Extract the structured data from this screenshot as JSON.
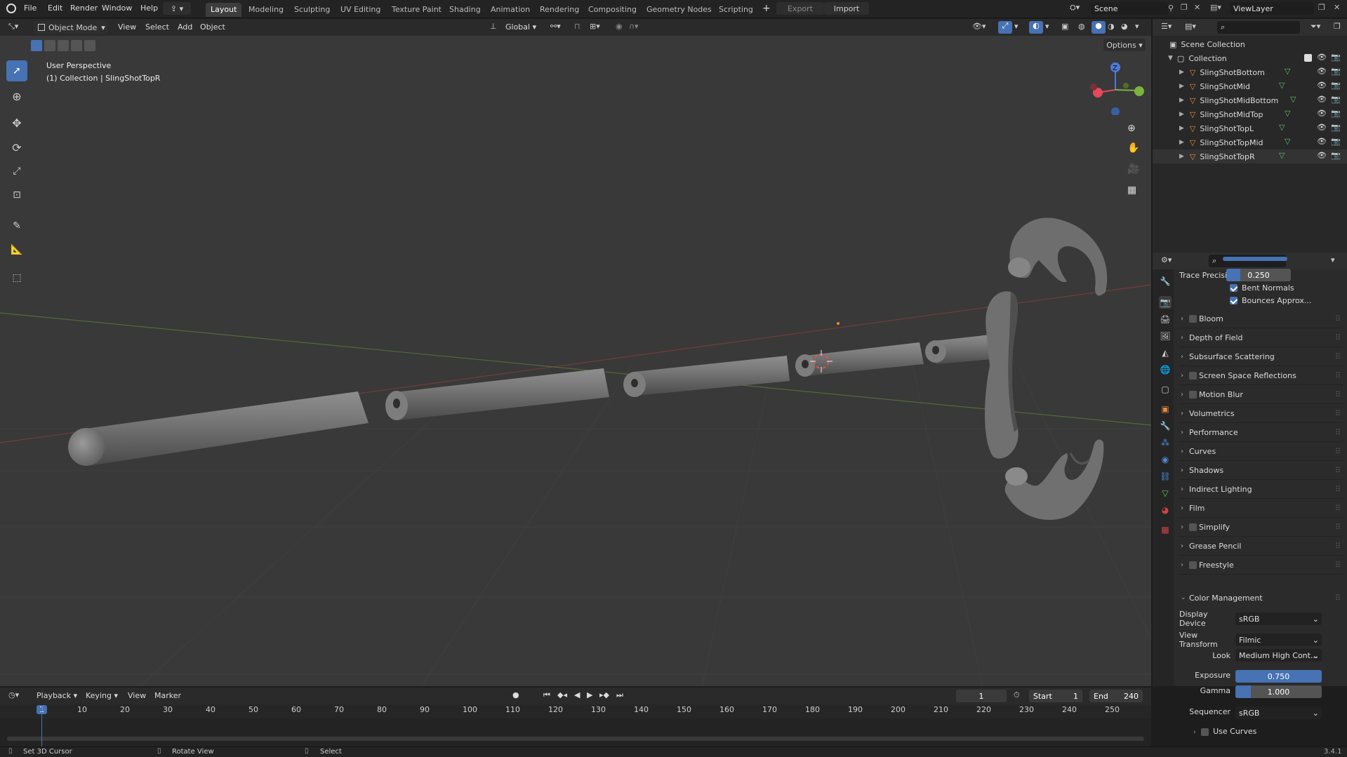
{
  "menubar": {
    "items": [
      "File",
      "Edit",
      "Render",
      "Window",
      "Help"
    ],
    "workspaces": [
      "Layout",
      "Modeling",
      "Sculpting",
      "UV Editing",
      "Texture Paint",
      "Shading",
      "Animation",
      "Rendering",
      "Compositing",
      "Geometry Nodes",
      "Scripting"
    ],
    "plus": "+",
    "export_label": "Export",
    "import_label": "Import",
    "scene_name": "Scene",
    "view_layer": "ViewLayer"
  },
  "viewport_header": {
    "mode": "Object Mode",
    "menus": [
      "View",
      "Select",
      "Add",
      "Object"
    ],
    "orientation": "Global",
    "options_label": "Options"
  },
  "viewport": {
    "perspective_label": "User Perspective",
    "collection_label": "(1) Collection | SlingShotTopR",
    "gizmo_z": "Z"
  },
  "outliner": {
    "scene_collection": "Scene Collection",
    "collection": "Collection",
    "objects": [
      "SlingShotBottom",
      "SlingShotMid",
      "SlingShotMidBottom",
      "SlingShotMidTop",
      "SlingShotTopL",
      "SlingShotTopMid",
      "SlingShotTopR"
    ]
  },
  "properties": {
    "trace_precision_label": "Trace Precision",
    "trace_precision_value": "0.250",
    "bent_normals": "Bent Normals",
    "bounces_approx": "Bounces Approx...",
    "panels": [
      "Bloom",
      "Depth of Field",
      "Subsurface Scattering",
      "Screen Space Reflections",
      "Motion Blur",
      "Volumetrics",
      "Performance",
      "Curves",
      "Shadows",
      "Indirect Lighting",
      "Film",
      "Simplify",
      "Grease Pencil",
      "Freestyle"
    ],
    "panels_with_checkbox": [
      "Bloom",
      "Screen Space Reflections",
      "Motion Blur",
      "Simplify",
      "Freestyle"
    ],
    "color_management": {
      "title": "Color Management",
      "display_device_label": "Display Device",
      "display_device": "sRGB",
      "view_transform_label": "View Transform",
      "view_transform": "Filmic",
      "look_label": "Look",
      "look": "Medium High Cont...",
      "exposure_label": "Exposure",
      "exposure": "0.750",
      "gamma_label": "Gamma",
      "gamma": "1.000",
      "sequencer_label": "Sequencer",
      "sequencer": "sRGB",
      "use_curves": "Use Curves"
    }
  },
  "timeline": {
    "menus": [
      "Playback",
      "Keying",
      "View",
      "Marker"
    ],
    "current_frame": "1",
    "start_label": "Start",
    "start": "1",
    "end_label": "End",
    "end": "240",
    "ticks": [
      "1",
      "10",
      "20",
      "30",
      "40",
      "50",
      "60",
      "70",
      "80",
      "90",
      "100",
      "110",
      "120",
      "130",
      "140",
      "150",
      "160",
      "170",
      "180",
      "190",
      "200",
      "210",
      "220",
      "230",
      "240",
      "250"
    ]
  },
  "statusbar": {
    "set_cursor": "Set 3D Cursor",
    "rotate_view": "Rotate View",
    "select": "Select",
    "version": "3.4.1"
  },
  "colors": {
    "accent": "#4772b3",
    "object_orange": "#e88a3a",
    "mesh_green": "#5fc06d"
  }
}
